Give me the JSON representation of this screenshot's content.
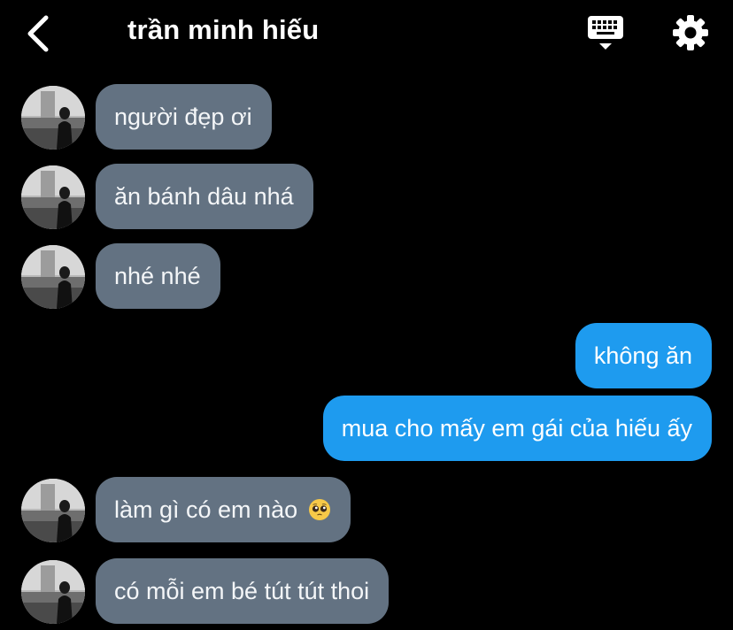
{
  "header": {
    "title": "trần minh hiếu",
    "back_icon": "chevron-left-icon",
    "keyboard_icon": "keyboard-icon",
    "settings_icon": "gear-icon"
  },
  "colors": {
    "background": "#000000",
    "incoming_bubble": "#637282",
    "outgoing_bubble": "#1e9bef"
  },
  "messages": [
    {
      "direction": "incoming",
      "text": "người đẹp ơi"
    },
    {
      "direction": "incoming",
      "text": "ăn bánh dâu nhá"
    },
    {
      "direction": "incoming",
      "text": "nhé nhé"
    },
    {
      "direction": "outgoing",
      "text": "không ăn"
    },
    {
      "direction": "outgoing",
      "text": "mua cho mấy em gái của hiếu ấy"
    },
    {
      "direction": "incoming",
      "text": "làm gì có em nào",
      "emoji": "pleading-face-emoji"
    },
    {
      "direction": "incoming",
      "text": "có mỗi em bé tút tút thoi"
    }
  ]
}
